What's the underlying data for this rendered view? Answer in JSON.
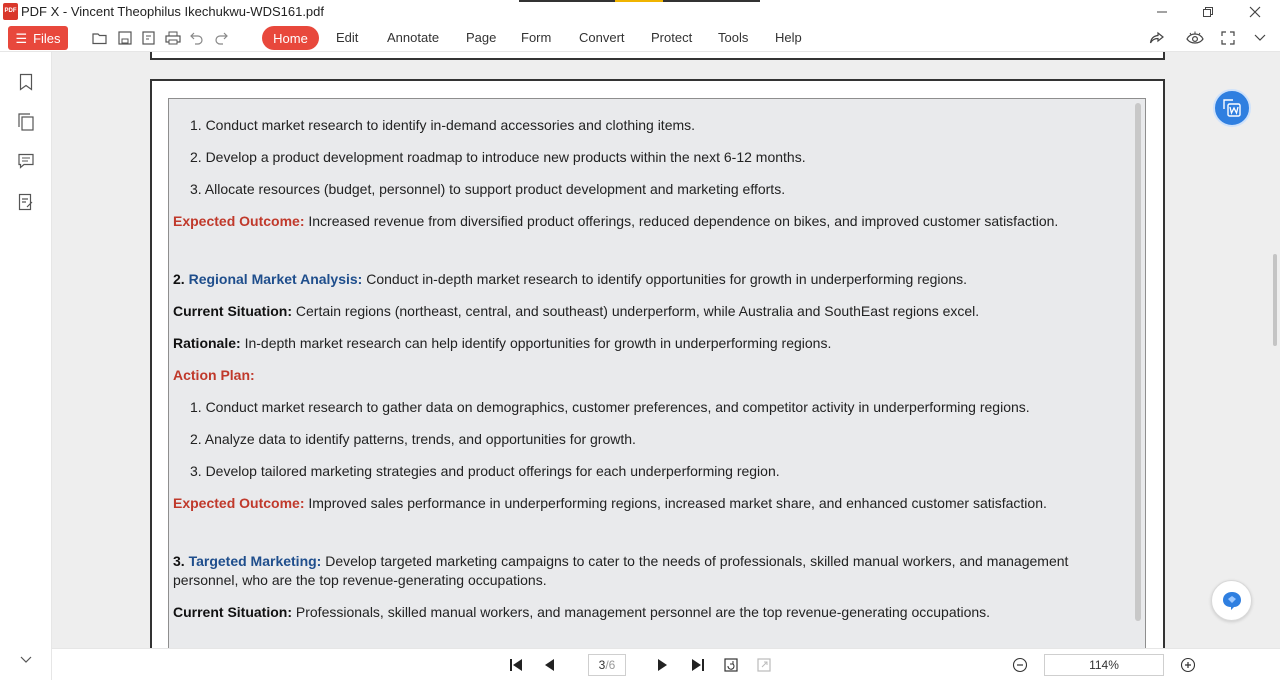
{
  "window": {
    "title": "PDF X - Vincent Theophilus Ikechukwu-WDS161.pdf",
    "app_logo": "PDF X"
  },
  "toolbar": {
    "files_label": "Files",
    "menu": [
      "Home",
      "Edit",
      "Annotate",
      "Page",
      "Form",
      "Convert",
      "Protect",
      "Tools",
      "Help"
    ]
  },
  "document": {
    "list_a": [
      "1. Conduct market research to identify in-demand accessories and clothing items.",
      "2. Develop a product development roadmap to introduce new products within the next 6-12 months.",
      "3. Allocate resources (budget, personnel) to support product development and marketing efforts."
    ],
    "outcome_a": {
      "label": "Expected Outcome:",
      "text": " Increased revenue from diversified product offerings, reduced dependence on bikes, and improved customer satisfaction."
    },
    "section2": {
      "number": "2. ",
      "title": "Regional Market Analysis:",
      "text": " Conduct in-depth market research to identify opportunities for growth in underperforming regions.",
      "situation_label": "Current Situation:",
      "situation_text": " Certain regions (northeast, central, and southeast) underperform, while Australia and SouthEast regions excel.",
      "rationale_label": "Rationale:",
      "rationale_text": " In-depth market research can help identify opportunities for growth in underperforming regions.",
      "action_label": "Action Plan:",
      "actions": [
        "1. Conduct market research to gather data on demographics, customer preferences, and competitor activity in underperforming regions.",
        "2. Analyze data to identify patterns, trends, and opportunities for growth.",
        "3. Develop tailored marketing strategies and product offerings for each underperforming region."
      ],
      "outcome_label": "Expected Outcome:",
      "outcome_text": " Improved sales performance in underperforming regions, increased market share, and enhanced customer satisfaction."
    },
    "section3": {
      "number": "3. ",
      "title": "Targeted Marketing:",
      "text_line1": " Develop targeted marketing campaigns to cater to the needs of professionals, skilled manual workers, and management",
      "text_line2": "personnel, who are the top revenue-generating occupations.",
      "situation_label": "Current Situation:",
      "situation_text": " Professionals, skilled manual workers, and management personnel are the top revenue-generating occupations."
    }
  },
  "bottombar": {
    "current_page": "3",
    "separator": "/",
    "total_pages": "6",
    "zoom": "114%"
  },
  "colors": {
    "accent": "#e8483c",
    "label_red": "#c0392b",
    "label_blue": "#1f4e8c",
    "fab_blue": "#2f7fe0"
  }
}
